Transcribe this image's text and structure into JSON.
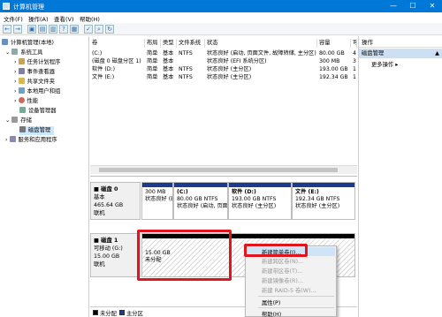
{
  "window": {
    "title": "计算机管理"
  },
  "menubar": [
    "文件(F)",
    "操作(A)",
    "查看(V)",
    "帮助(H)"
  ],
  "tree": {
    "root": "计算机管理(本地)",
    "system_tools": "系统工具",
    "task_scheduler": "任务计划程序",
    "event_viewer": "事件查看器",
    "shared_folders": "共享文件夹",
    "local_users": "本地用户和组",
    "performance": "性能",
    "device_manager": "设备管理器",
    "storage": "存储",
    "disk_management": "磁盘管理",
    "services": "服务和应用程序"
  },
  "volume_table": {
    "headers": [
      "卷",
      "布局",
      "类型",
      "文件系统",
      "状态",
      "容量",
      "可"
    ],
    "rows": [
      [
        "(C:)",
        "简单",
        "基本",
        "NTFS",
        "状态良好 (启动, 页面文件, 故障转储, 主分区)",
        "80.00 GB",
        "4"
      ],
      [
        "(磁盘 0 磁盘分区 1)",
        "简单",
        "基本",
        "",
        "状态良好 (EFI 系统分区)",
        "300 MB",
        "3"
      ],
      [
        "软件 (D:)",
        "简单",
        "基本",
        "NTFS",
        "状态良好 (主分区)",
        "193.00 GB",
        "1"
      ],
      [
        "文件 (E:)",
        "简单",
        "基本",
        "NTFS",
        "状态良好 (主分区)",
        "192.34 GB",
        "1"
      ]
    ]
  },
  "disk0": {
    "name": "磁盘 0",
    "type": "基本",
    "size": "465.64 GB",
    "status": "联机",
    "partitions": [
      {
        "title": "",
        "size": "300 MB",
        "status": "状态良好 (EFI 系统"
      },
      {
        "title": "(C:)",
        "size": "80.00 GB NTFS",
        "status": "状态良好 (启动, 页面"
      },
      {
        "title": "软件 (D:)",
        "size": "193.00 GB NTFS",
        "status": "状态良好 (主分区)"
      },
      {
        "title": "文件 (E:)",
        "size": "192.34 GB NTFS",
        "status": "状态良好 (主分区)"
      }
    ]
  },
  "disk1": {
    "name": "磁盘 1",
    "type": "可移动 (G:)",
    "size": "15.00 GB",
    "status": "联机",
    "unalloc_size": "15.00 GB",
    "unalloc_label": "未分配"
  },
  "legend": [
    "未分配",
    "主分区"
  ],
  "actions": {
    "header": "操作",
    "selected": "磁盘管理",
    "more": "更多操作"
  },
  "context_menu": {
    "items": [
      {
        "label": "新建简单卷(I)...",
        "enabled": true
      },
      {
        "label": "新建跨区卷(N)...",
        "enabled": false
      },
      {
        "label": "新建带区卷(T)...",
        "enabled": false
      },
      {
        "label": "新建镜像卷(R)...",
        "enabled": false
      },
      {
        "label": "新建 RAID-5 卷(W)...",
        "enabled": false
      },
      {
        "label": "属性(P)",
        "enabled": true
      },
      {
        "label": "帮助(H)",
        "enabled": true
      }
    ]
  },
  "colors": {
    "titlebar": "#0078d7",
    "primary_partition": "#1b3b8f",
    "unallocated": "#000000",
    "highlight": "#e0161c"
  }
}
